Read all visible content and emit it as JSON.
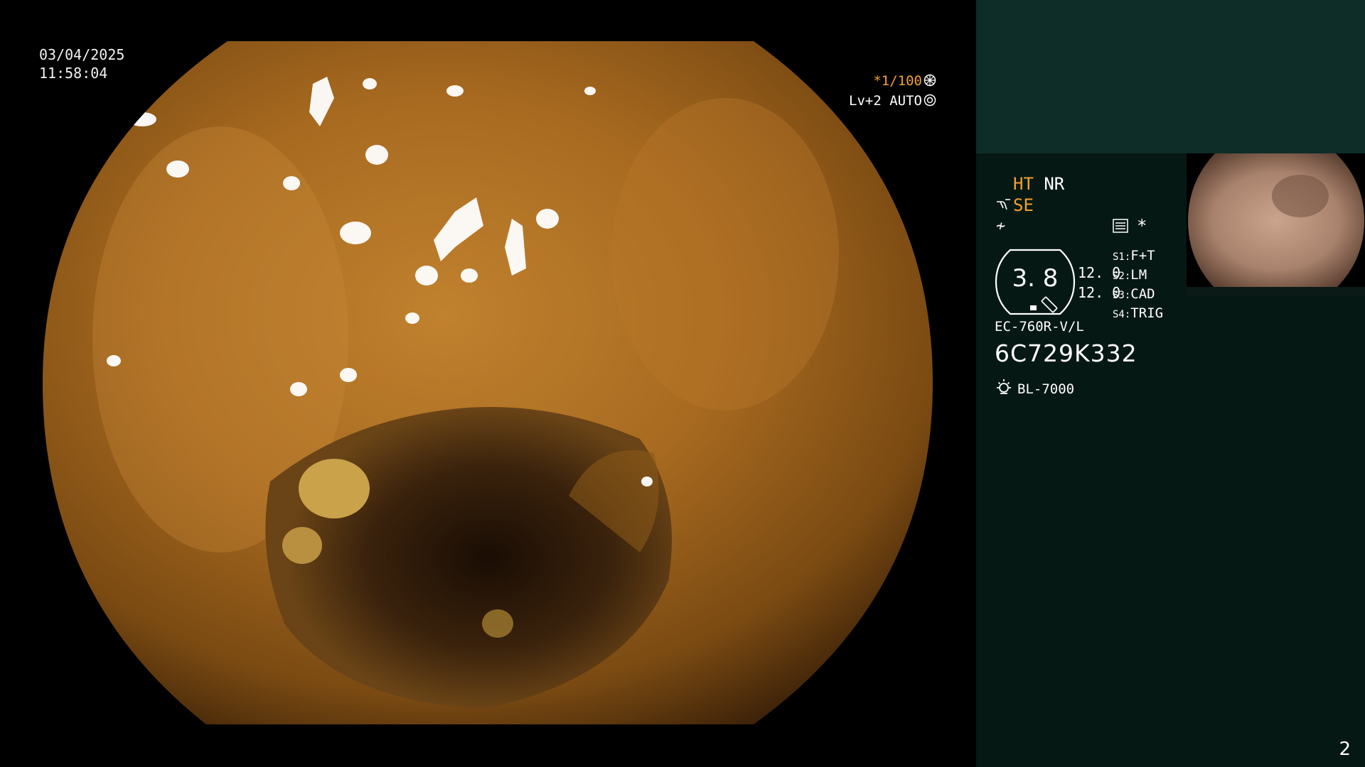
{
  "overlay": {
    "date": "03/04/2025",
    "time": "11:58:04",
    "shutter": "*1/100",
    "level": "Lv+2 AUTO"
  },
  "panel": {
    "ht": "HT",
    "nr": "NR",
    "se": "SE",
    "f_symbol": "≁",
    "star": "*",
    "gauge_value": "3. 8",
    "value_1": "12. 0",
    "value_2": "12. 0",
    "switches": [
      {
        "key": "S1",
        "label": "F+T"
      },
      {
        "key": "S2",
        "label": "LM"
      },
      {
        "key": "S3",
        "label": "CAD"
      },
      {
        "key": "S4",
        "label": "TRIG"
      }
    ],
    "scope_model": "EC-760R-V/L",
    "serial": "6C729K332",
    "light_source": "BL-7000"
  },
  "page_number": "2",
  "colors": {
    "accent_orange": "#f0a030",
    "panel_bg": "#061814",
    "panel_top_bg": "#0e2c28"
  }
}
